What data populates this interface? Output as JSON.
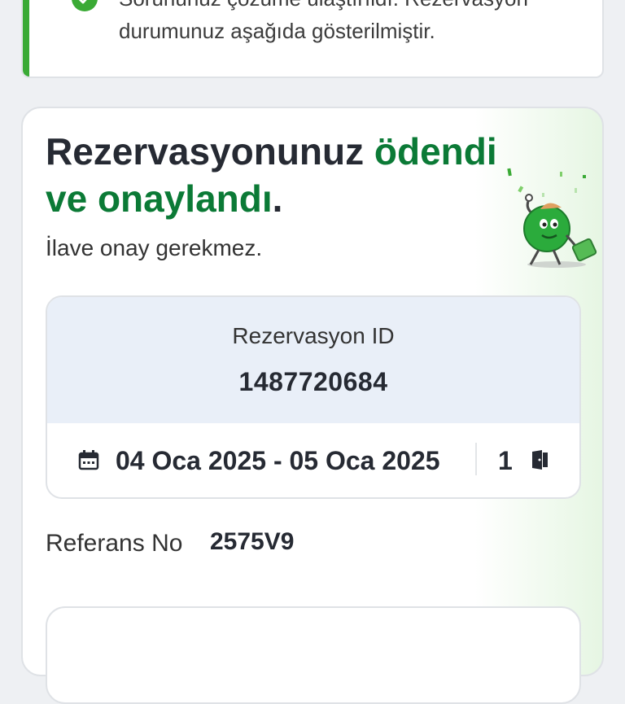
{
  "notice": {
    "text": "Sorununuz çözüme ulaştırıldı. Rezervasyon durumunuz aşağıda gösterilmiştir.",
    "accent_color": "#3aaa35",
    "icon": "check-circle-icon"
  },
  "status_card": {
    "headline_part1": "Rezervasyonunuz ",
    "headline_highlight": "ödendi ve onaylandı",
    "headline_end": ".",
    "subtext": "İlave onay gerekmez.",
    "highlight_color": "#0b7a36",
    "illustration": "celebrating-mascot-illustration"
  },
  "reservation": {
    "id_label": "Rezervasyon ID",
    "id_value": "1487720684",
    "dates": "04 Oca 2025 - 05 Oca 2025",
    "room_count": "1",
    "calendar_icon": "calendar-icon",
    "room_icon": "door-icon"
  },
  "reference": {
    "label": "Referans No",
    "value": "2575V9"
  }
}
